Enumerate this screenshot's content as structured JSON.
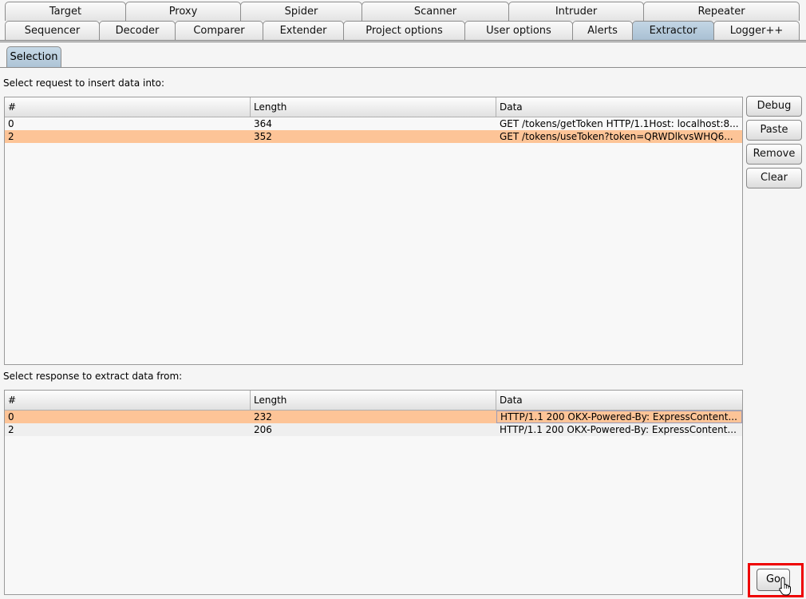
{
  "tabs_row1": [
    {
      "label": "Target"
    },
    {
      "label": "Proxy"
    },
    {
      "label": "Spider"
    },
    {
      "label": "Scanner"
    },
    {
      "label": "Intruder"
    },
    {
      "label": "Repeater"
    }
  ],
  "tabs_row2": [
    {
      "label": "Sequencer"
    },
    {
      "label": "Decoder"
    },
    {
      "label": "Comparer"
    },
    {
      "label": "Extender"
    },
    {
      "label": "Project options"
    },
    {
      "label": "User options"
    },
    {
      "label": "Alerts"
    },
    {
      "label": "Extractor",
      "active": true
    },
    {
      "label": "Logger++"
    }
  ],
  "subtab": {
    "label": "Selection"
  },
  "request_section": {
    "label": "Select request to insert data into:",
    "columns": [
      "#",
      "Length",
      "Data"
    ],
    "rows": [
      {
        "id": "0",
        "length": "364",
        "data": "GET /tokens/getToken HTTP/1.1Host: localhost:8...",
        "selected": false
      },
      {
        "id": "2",
        "length": "352",
        "data": "GET /tokens/useToken?token=QRWDlkvsWHQ6...",
        "selected": true
      }
    ]
  },
  "response_section": {
    "label": "Select response to extract data from:",
    "columns": [
      "#",
      "Length",
      "Data"
    ],
    "rows": [
      {
        "id": "0",
        "length": "232",
        "data": "HTTP/1.1 200 OKX-Powered-By: ExpressContent...",
        "selected": true
      },
      {
        "id": "2",
        "length": "206",
        "data": "HTTP/1.1 200 OKX-Powered-By: ExpressContent...",
        "selected": false
      }
    ]
  },
  "buttons": {
    "debug": "Debug",
    "paste": "Paste",
    "remove": "Remove",
    "clear": "Clear",
    "go": "Go"
  },
  "colors": {
    "active_tab": "#b4c9db",
    "selected_row": "#fdc497",
    "highlight": "#e00000"
  }
}
